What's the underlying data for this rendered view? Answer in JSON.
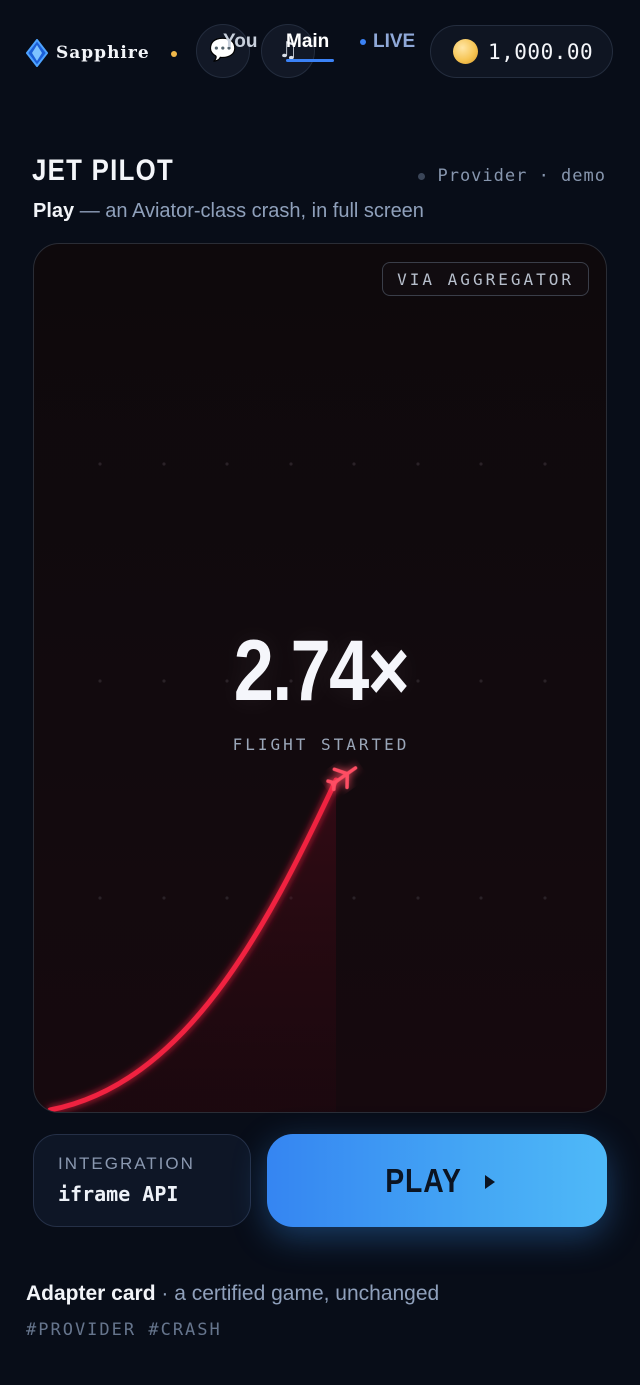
{
  "topbar": {
    "brand": "Sapphire",
    "tabs": [
      {
        "label": "You"
      },
      {
        "label": "Main",
        "active": true
      },
      {
        "label": "LIVE"
      }
    ],
    "balance": "1,000.00",
    "icons": {
      "chat": "chat-bubble-icon",
      "music": "music-note-icon",
      "coin": "coin-icon",
      "brand": "diamond-icon"
    }
  },
  "header": {
    "title": "JET PILOT",
    "provider_text": "Provider · demo",
    "subtitle_bold": "Play",
    "subtitle_rest": " — an Aviator-class crash, in full screen"
  },
  "game": {
    "badge": "VIA AGGREGATOR",
    "multiplier": "2.74×",
    "status": "FLIGHT STARTED",
    "icons": {
      "plane": "airplane-icon"
    }
  },
  "controls": {
    "integration_label": "INTEGRATION",
    "integration_value": "iframe API",
    "play_label": "PLAY",
    "icons": {
      "play": "play-arrow-icon"
    }
  },
  "footer": {
    "caption_bold": "Adapter card",
    "caption_rest": " · a certified game, unchanged",
    "tags": "#PROVIDER #CRASH"
  },
  "colors": {
    "background": "#080d18",
    "accent_blue": "#3b82f6",
    "curve_red": "#f0203f",
    "coin_gold": "#f6c555"
  }
}
